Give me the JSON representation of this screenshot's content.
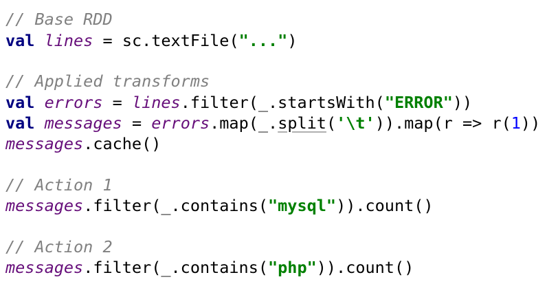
{
  "code": {
    "c_base": "// Base RDD",
    "kw_val": "val",
    "lines_var": "lines",
    "assign": " = ",
    "sc_textfile": "sc.textFile(",
    "ellipsis_str": "\"...\"",
    "close_paren": ")",
    "c_applied": "// Applied transforms",
    "errors_var": "errors",
    "filter_open": ".filter(_.startsWith(",
    "error_str": "\"ERROR\"",
    "close2": "))",
    "messages_var": "messages",
    "map_open": ".map(_.",
    "split_fn": "split",
    "paren_open": "(",
    "tab_str": "'\\t'",
    "map_lambda": ")).map(r => r(",
    "one": "1",
    "cache_call": ".cache()",
    "c_action1": "// Action 1",
    "contains_open": ".filter(_.contains(",
    "mysql_str": "\"mysql\"",
    "count_call": ")).count()",
    "c_action2": "// Action 2",
    "php_str": "\"php\""
  }
}
